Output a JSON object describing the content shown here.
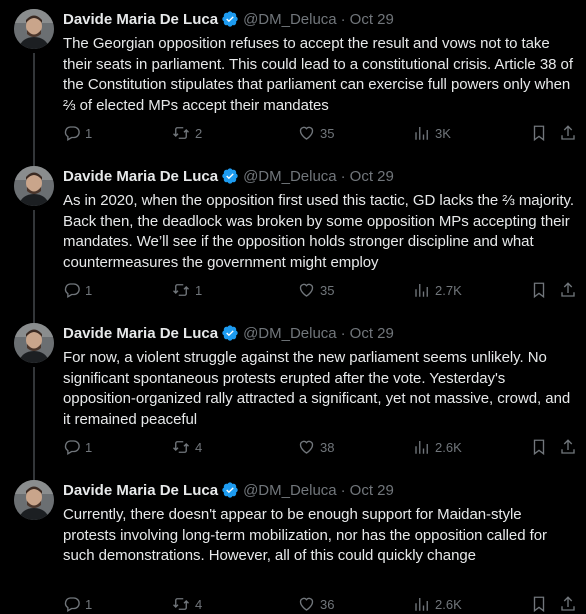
{
  "author": {
    "display_name": "Davide Maria De Luca",
    "handle": "@DM_Deluca",
    "date": "Oct 29",
    "separator": "·",
    "verified_color": "#1d9bf0"
  },
  "tweets": [
    {
      "text": "The Georgian opposition refuses to accept the result and vows not to take their seats in parliament. This could lead to a constitutional crisis. Article 38 of the Constitution stipulates that parliament can exercise full powers only when ⅔ of elected MPs accept their mandates",
      "replies": "1",
      "reposts": "2",
      "likes": "35",
      "views": "3K"
    },
    {
      "text": "As in 2020, when the opposition first used this tactic, GD lacks the ⅔ majority. Back then, the deadlock was broken by some opposition MPs accepting their mandates. We’ll see if the opposition holds stronger discipline and what countermeasures the government might employ",
      "replies": "1",
      "reposts": "1",
      "likes": "35",
      "views": "2.7K"
    },
    {
      "text": "For now, a violent struggle against the new parliament seems unlikely. No significant spontaneous protests erupted after the vote. Yesterday's opposition-organized rally attracted a significant, yet not massive, crowd, and it remained peaceful",
      "replies": "1",
      "reposts": "4",
      "likes": "38",
      "views": "2.6K"
    },
    {
      "text": "Currently, there doesn't appear to be enough support for Maidan-style protests involving long-term mobilization, nor has the opposition called for such demonstrations. However, all of this could quickly change",
      "replies": "1",
      "reposts": "4",
      "likes": "36",
      "views": "2.6K"
    }
  ],
  "icons": {
    "reply": "reply-icon",
    "repost": "repost-icon",
    "like": "heart-icon",
    "views": "views-chart-icon",
    "bookmark": "bookmark-icon",
    "share": "share-icon",
    "verified": "verified-badge-icon"
  }
}
